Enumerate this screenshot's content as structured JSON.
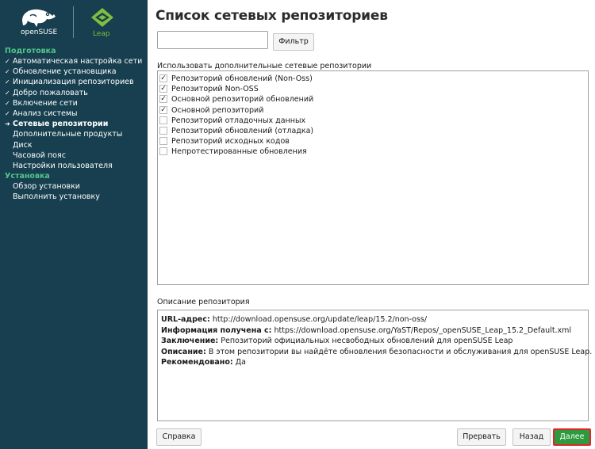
{
  "brand": {
    "opensuse_text": "openSUSE",
    "leap_text": "Leap",
    "colors": {
      "sidebar_bg": "#173f4f",
      "section_green": "#52c58a",
      "leap_green": "#7fbf3f",
      "next_button_green": "#2e9a3d",
      "highlight_red": "#e3242b"
    }
  },
  "sidebar": {
    "sections": [
      {
        "title": "Подготовка",
        "steps": [
          {
            "label": "Автоматическая настройка сети",
            "mark": "✓"
          },
          {
            "label": "Обновление установщика",
            "mark": "✓"
          },
          {
            "label": "Инициализация репозиториев",
            "mark": "✓"
          },
          {
            "label": "Добро пожаловать",
            "mark": "✓"
          },
          {
            "label": "Включение сети",
            "mark": "✓"
          },
          {
            "label": "Анализ системы",
            "mark": "✓"
          },
          {
            "label": "Сетевые репозитории",
            "mark": "➜"
          },
          {
            "label": "Дополнительные продукты",
            "mark": ""
          },
          {
            "label": "Диск",
            "mark": ""
          },
          {
            "label": "Часовой пояс",
            "mark": ""
          },
          {
            "label": "Настройки пользователя",
            "mark": ""
          }
        ]
      },
      {
        "title": "Установка",
        "steps": [
          {
            "label": "Обзор установки",
            "mark": ""
          },
          {
            "label": "Выполнить установку",
            "mark": ""
          }
        ]
      }
    ]
  },
  "main": {
    "title": "Список сетевых репозиториев",
    "filter": {
      "value": "",
      "button_label": "Фильтр"
    },
    "repo_list_label": "Использовать дополнительные сетевые репозитории",
    "repositories": [
      {
        "label": "Репозиторий обновлений (Non-Oss)",
        "checked": true
      },
      {
        "label": "Репозиторий Non-OSS",
        "checked": true
      },
      {
        "label": "Основной репозиторий обновлений",
        "checked": true
      },
      {
        "label": "Основной репозиторий",
        "checked": true
      },
      {
        "label": "Репозиторий отладочных данных",
        "checked": false
      },
      {
        "label": "Репозиторий обновлений (отладка)",
        "checked": false
      },
      {
        "label": "Репозиторий исходных кодов",
        "checked": false
      },
      {
        "label": "Непротестированные обновления",
        "checked": false
      }
    ],
    "description": {
      "label": "Описание репозитория",
      "lines": [
        {
          "key": "URL-адрес:",
          "value": " http://download.opensuse.org/update/leap/15.2/non-oss/"
        },
        {
          "key": "Информация получена с:",
          "value": " https://download.opensuse.org/YaST/Repos/_openSUSE_Leap_15.2_Default.xml"
        },
        {
          "key": "Заключение:",
          "value": " Репозиторий официальных несвободных обновлений для openSUSE Leap"
        },
        {
          "key": "Описание:",
          "value": " В этом репозитории вы найдёте обновления безопасности и обслуживания для openSUSE Leap."
        },
        {
          "key": "Рекомендовано:",
          "value": " Да"
        }
      ]
    }
  },
  "footer": {
    "help_label": "Справка",
    "abort_label": "Прервать",
    "back_label": "Назад",
    "next_label": "Далее"
  }
}
